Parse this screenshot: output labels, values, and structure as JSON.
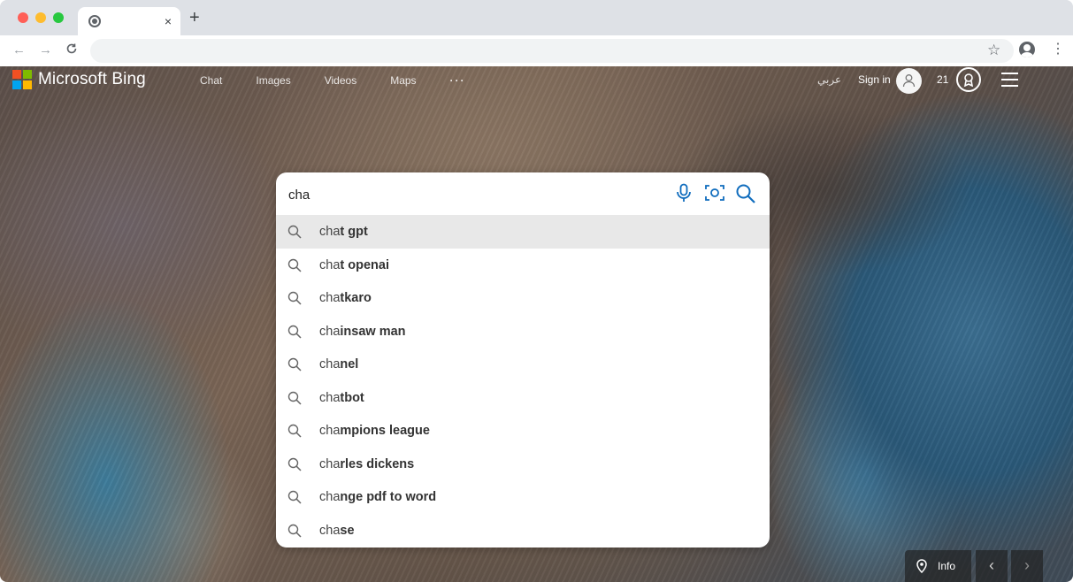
{
  "browser": {
    "tab": {
      "close": "×"
    },
    "new_tab": "+",
    "nav": {
      "back": "←",
      "forward": "→",
      "reload": "C"
    },
    "star": "☆",
    "menu": "⋮"
  },
  "bing": {
    "logo_text": "Microsoft Bing",
    "nav": [
      "Chat",
      "Images",
      "Videos",
      "Maps",
      "···"
    ],
    "language": "عربي",
    "sign_in": "Sign in",
    "rewards_points": "21",
    "search": {
      "query": "cha",
      "suggestions": [
        {
          "prefix": "cha",
          "completion": "t gpt"
        },
        {
          "prefix": "cha",
          "completion": "t openai"
        },
        {
          "prefix": "cha",
          "completion": "tkaro"
        },
        {
          "prefix": "cha",
          "completion": "insaw man"
        },
        {
          "prefix": "cha",
          "completion": "nel"
        },
        {
          "prefix": "cha",
          "completion": "tbot"
        },
        {
          "prefix": "cha",
          "completion": "mpions league"
        },
        {
          "prefix": "cha",
          "completion": "rles dickens"
        },
        {
          "prefix": "cha",
          "completion": "nge pdf to word"
        },
        {
          "prefix": "cha",
          "completion": "se"
        }
      ]
    },
    "footer": {
      "info": "Info",
      "prev": "‹",
      "next": "›"
    }
  },
  "colors": {
    "accent": "#0f6cbd",
    "bing_background": "#5c4f4a"
  },
  "icons": [
    "chrome-icon",
    "star-icon",
    "profile-icon",
    "mic-icon",
    "visual-search-icon",
    "search-icon",
    "location-pin-icon",
    "rewards-icon",
    "hamburger-menu-icon"
  ]
}
